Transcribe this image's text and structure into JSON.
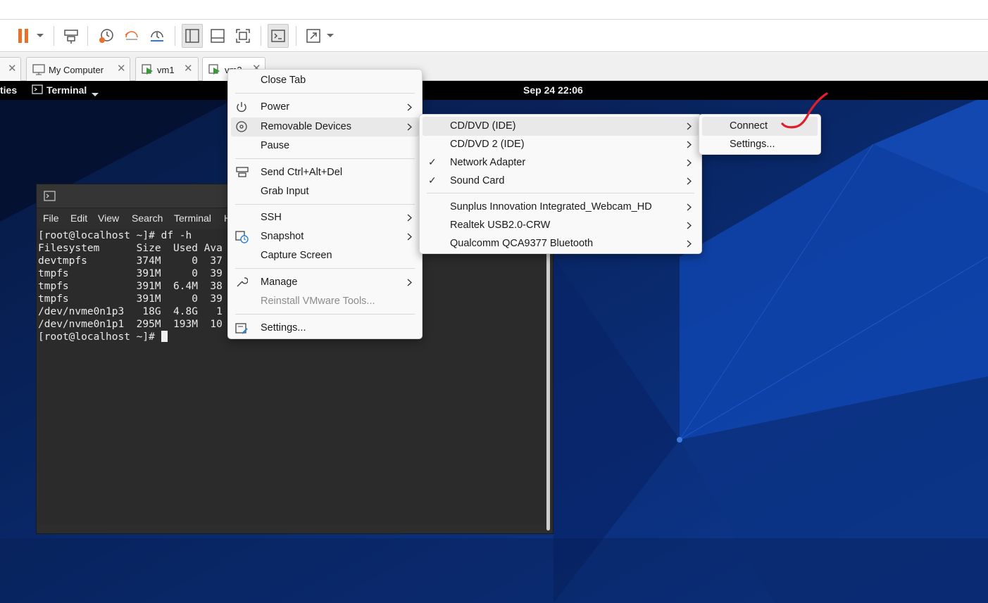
{
  "tabs": [
    {
      "label": ""
    },
    {
      "label": "My Computer"
    },
    {
      "label": "vm1"
    },
    {
      "label": "vm2"
    }
  ],
  "gnome": {
    "activities": "ties",
    "app": "Terminal",
    "clock": "Sep 24  22:06"
  },
  "terminal": {
    "menu": [
      "File",
      "Edit",
      "View",
      "Search",
      "Terminal",
      "H"
    ],
    "lines": [
      "[root@localhost ~]# df -h",
      "Filesystem      Size  Used Ava",
      "devtmpfs        374M     0  37",
      "tmpfs           391M     0  39",
      "tmpfs           391M  6.4M  38",
      "tmpfs           391M     0  39",
      "/dev/nvme0n1p3   18G  4.8G   1",
      "/dev/nvme0n1p1  295M  193M  10",
      "[root@localhost ~]# "
    ]
  },
  "context_menu": {
    "close_tab": "Close Tab",
    "power": "Power",
    "removable_devices": "Removable Devices",
    "pause": "Pause",
    "send_ctrl_alt_del": "Send Ctrl+Alt+Del",
    "grab_input": "Grab Input",
    "ssh": "SSH",
    "snapshot": "Snapshot",
    "capture_screen": "Capture Screen",
    "manage": "Manage",
    "reinstall_tools": "Reinstall VMware Tools...",
    "settings": "Settings..."
  },
  "removable_menu": {
    "items": [
      {
        "label": "CD/DVD (IDE)",
        "checked": false
      },
      {
        "label": "CD/DVD 2 (IDE)",
        "checked": false
      },
      {
        "label": "Network Adapter",
        "checked": true
      },
      {
        "label": "Sound Card",
        "checked": true
      },
      {
        "label": "Sunplus Innovation Integrated_Webcam_HD",
        "checked": false
      },
      {
        "label": "Realtek USB2.0-CRW",
        "checked": false
      },
      {
        "label": "Qualcomm QCA9377 Bluetooth",
        "checked": false
      }
    ]
  },
  "cd_menu": {
    "connect": "Connect",
    "settings": "Settings..."
  },
  "colors": {
    "accent_pause": "#e8702a",
    "annotation": "#e01f2a",
    "vm_background": "#0a2a6a"
  }
}
